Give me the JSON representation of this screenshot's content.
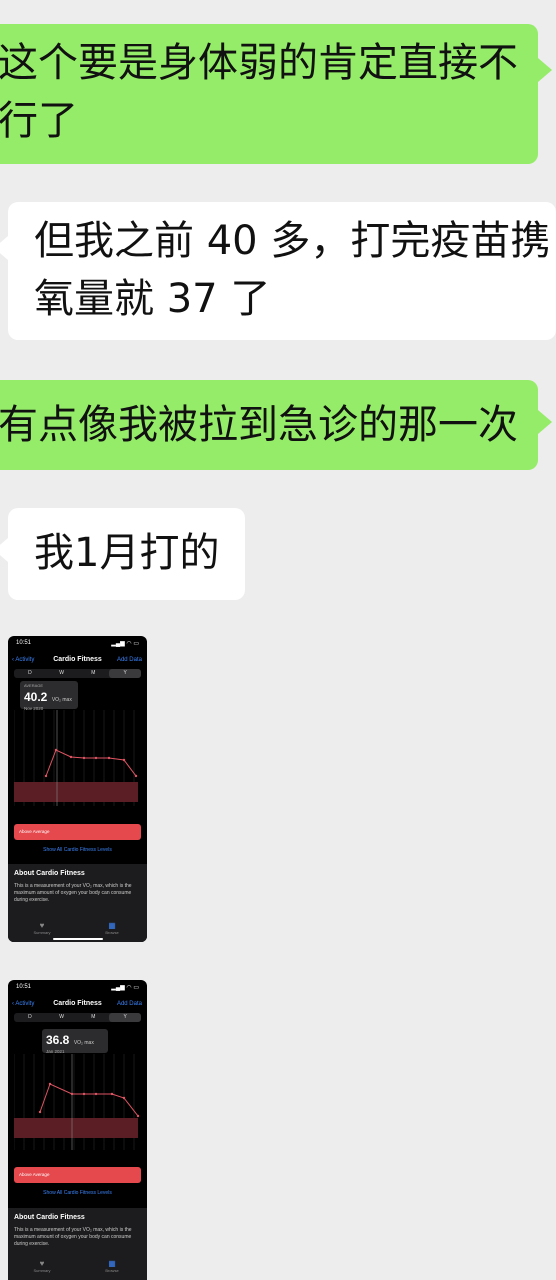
{
  "messages": [
    {
      "side": "right",
      "text_line1": "这个要是身体弱的肯定直接不",
      "text_line2": "行了"
    },
    {
      "side": "left",
      "text_line1": "但我之前 40 多，打完疫苗携",
      "text_line2": "氧量就 37 了"
    },
    {
      "side": "right",
      "text_line1": "有点像我被拉到急诊的那一次"
    },
    {
      "side": "left",
      "text_line1": "我1月打的"
    }
  ],
  "screenshots": [
    {
      "time": "10:51",
      "back": "Activity",
      "title": "Cardio Fitness",
      "add": "Add Data",
      "segments": [
        "D",
        "W",
        "M",
        "Y"
      ],
      "selected_segment": "Y",
      "callout_caption": "AVERAGE",
      "value": "40.2",
      "unit": "VO₂ max",
      "date": "Nov 2020",
      "band_label": "Above Average",
      "show_all": "Show All Cardio Fitness Levels",
      "about_title": "About Cardio Fitness",
      "about_text": "This is a measurement of your VO₂ max, which is the maximum amount of oxygen your body can consume during exercise.",
      "tab1": "Summary",
      "tab2": "Browse"
    },
    {
      "time": "10:51",
      "back": "Activity",
      "title": "Cardio Fitness",
      "add": "Add Data",
      "segments": [
        "D",
        "W",
        "M",
        "Y"
      ],
      "selected_segment": "Y",
      "value": "36.8",
      "unit": "VO₂ max",
      "date": "Jan 2021",
      "band_label": "Above Average",
      "show_all": "Show All Cardio Fitness Levels",
      "about_title": "About Cardio Fitness",
      "about_text": "This is a measurement of your VO₂ max, which is the maximum amount of oxygen your body can consume during exercise.",
      "tab1": "Summary",
      "tab2": "Browse"
    }
  ],
  "colors": {
    "bubble_green": "#95ec69",
    "bubble_white": "#ffffff",
    "chat_bg": "#ededed",
    "accent_blue": "#3b82f6",
    "band_red": "#e5484d"
  }
}
